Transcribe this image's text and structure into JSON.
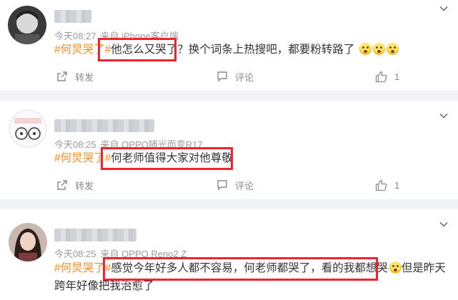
{
  "posts": [
    {
      "time": "今天08:27",
      "source": "来自 iPhone客户端",
      "hashtag": "#何炅哭了#",
      "text": "他怎么又哭了？换个词条上热搜吧，都要粉转路了",
      "emoji_count": 3,
      "repost_label": "转发",
      "comment_label": "评论",
      "like_count": "1"
    },
    {
      "time": "今天08:25",
      "source": "来自 OPPO随光而变R17",
      "hashtag": "#何炅哭了#",
      "text": "何老师值得大家对他尊敬",
      "repost_label": "转发",
      "comment_label": "评论",
      "like_count": "1"
    },
    {
      "time": "今天08:25",
      "source": "来自 OPPO Reno2 Z",
      "hashtag": "#何炅哭了#",
      "text_a": "感觉今年好多人都不容易，何老师都哭了，看的我都想哭",
      "text_b": "但是昨天跨年好像把我治愈了"
    }
  ],
  "colors": {
    "hashtag": "#f28b23",
    "highlight": "#f0232f",
    "divider": "#f1f2f5",
    "meta": "#9a9a9a"
  }
}
